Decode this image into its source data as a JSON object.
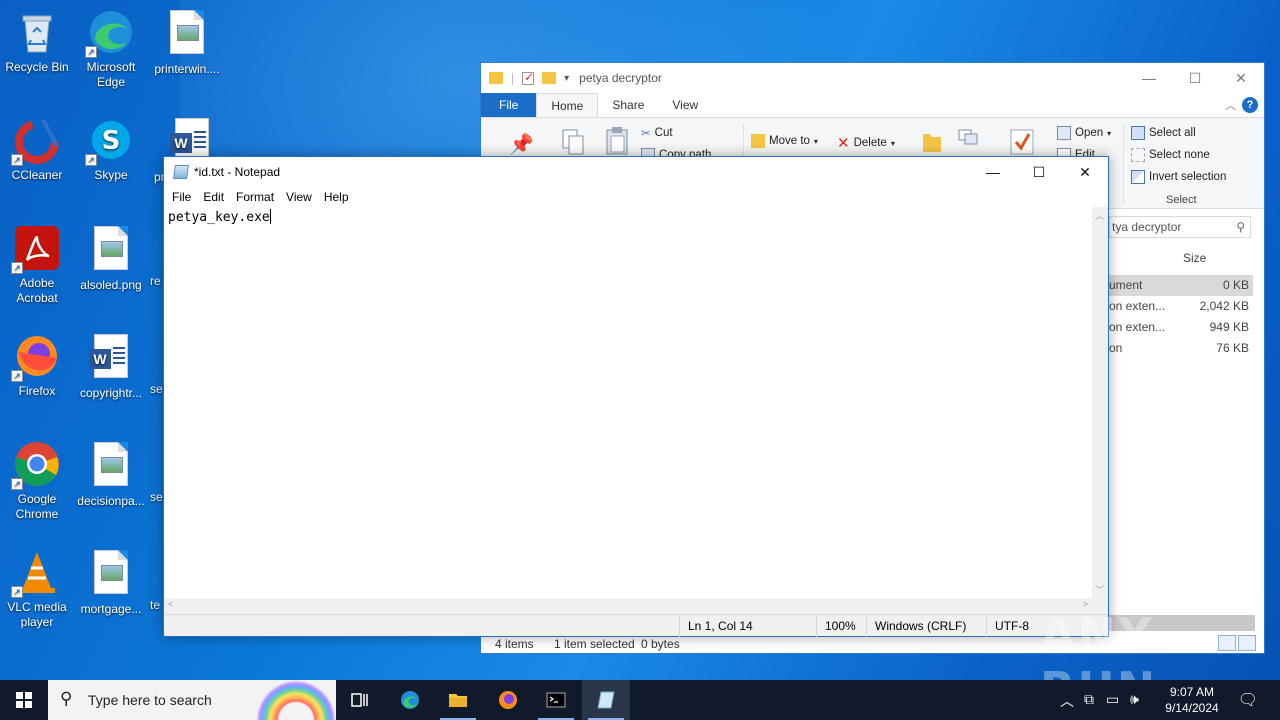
{
  "desktop": {
    "icons": [
      {
        "label": "Recycle Bin"
      },
      {
        "label": "Microsoft Edge"
      },
      {
        "label": "printerwin...."
      },
      {
        "label": "CCleaner"
      },
      {
        "label": "Skype"
      },
      {
        "label": "pr"
      },
      {
        "label": "Adobe Acrobat"
      },
      {
        "label": "alsoled.png"
      },
      {
        "label": "re"
      },
      {
        "label": "Firefox"
      },
      {
        "label": "copyrightr..."
      },
      {
        "label": "se"
      },
      {
        "label": "Google Chrome"
      },
      {
        "label": "decisionpa..."
      },
      {
        "label": "se"
      },
      {
        "label": "VLC media player"
      },
      {
        "label": "mortgage..."
      },
      {
        "label": "te"
      }
    ]
  },
  "explorer": {
    "title": "petya decryptor",
    "tabs": {
      "file": "File",
      "home": "Home",
      "share": "Share",
      "view": "View"
    },
    "ribbon": {
      "cut": "Cut",
      "copy_path": "Copy path",
      "move_to": "Move to",
      "delete": "Delete",
      "open": "Open",
      "edit": "Edit",
      "select_all": "Select all",
      "select_none": "Select none",
      "invert_selection": "Invert selection",
      "select_group": "Select"
    },
    "search_text": "tya decryptor",
    "column_size": "Size",
    "rows": [
      {
        "type": "ument",
        "size": "0 KB",
        "selected": true
      },
      {
        "type": "on exten...",
        "size": "2,042 KB"
      },
      {
        "type": "on exten...",
        "size": "949 KB"
      },
      {
        "type": "on",
        "size": "76 KB"
      }
    ],
    "status": {
      "items": "4 items",
      "selected": "1 item selected",
      "bytes": "0 bytes"
    }
  },
  "notepad": {
    "title": "*id.txt - Notepad",
    "menu": {
      "file": "File",
      "edit": "Edit",
      "format": "Format",
      "view": "View",
      "help": "Help"
    },
    "content": "petya_key.exe",
    "status": {
      "position": "Ln 1, Col 14",
      "zoom": "100%",
      "line_ending": "Windows (CRLF)",
      "encoding": "UTF-8"
    }
  },
  "watermark": "ANY RUN",
  "taskbar": {
    "search_placeholder": "Type here to search",
    "time": "9:07 AM",
    "date": "9/14/2024"
  }
}
